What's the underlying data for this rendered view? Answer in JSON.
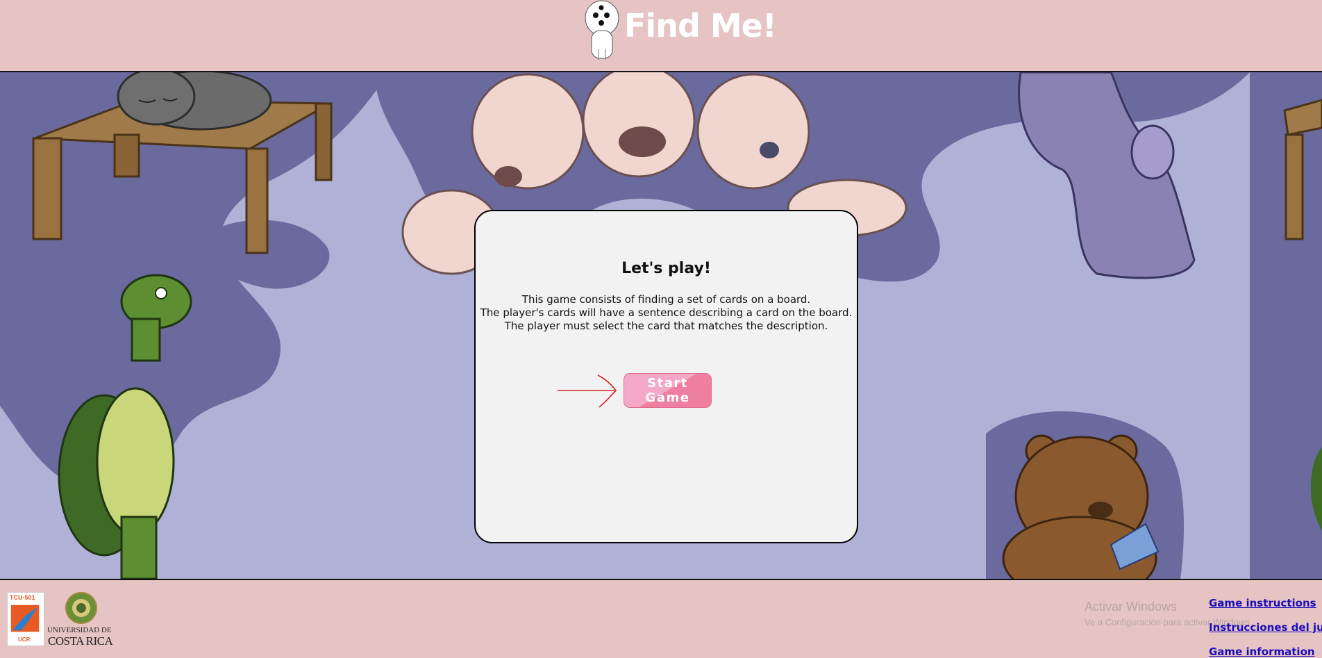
{
  "header": {
    "title": "Find Me!",
    "mascot_icon": "ghost-dog-mascot-icon"
  },
  "panel": {
    "heading": "Let's play!",
    "lines": [
      "This game consists of finding a set of cards on a board.",
      "The player's cards will have a sentence describing a card on the board.",
      "The player must select the card that matches the description."
    ],
    "start_label": "Start Game"
  },
  "footer": {
    "tcu_label_top": "TCU-501",
    "tcu_label_bottom": "UCR",
    "university_line1": "UNIVERSIDAD DE",
    "university_line2": "COSTA RICA",
    "watermark_title": "Activar Windows",
    "watermark_sub": "Ve a Configuración para activar Windows.",
    "links": {
      "instructions_en": "Game instructions",
      "instructions_es": "Instrucciones del juego",
      "information": "Game information"
    }
  },
  "colors": {
    "header_bg": "#e6c4c4",
    "scene_bg": "#b0b1d6",
    "panel_bg": "#f2f2f2",
    "button_pink": "#f4a8c7",
    "link": "#1a0dbb",
    "arrow": "#d42020"
  }
}
